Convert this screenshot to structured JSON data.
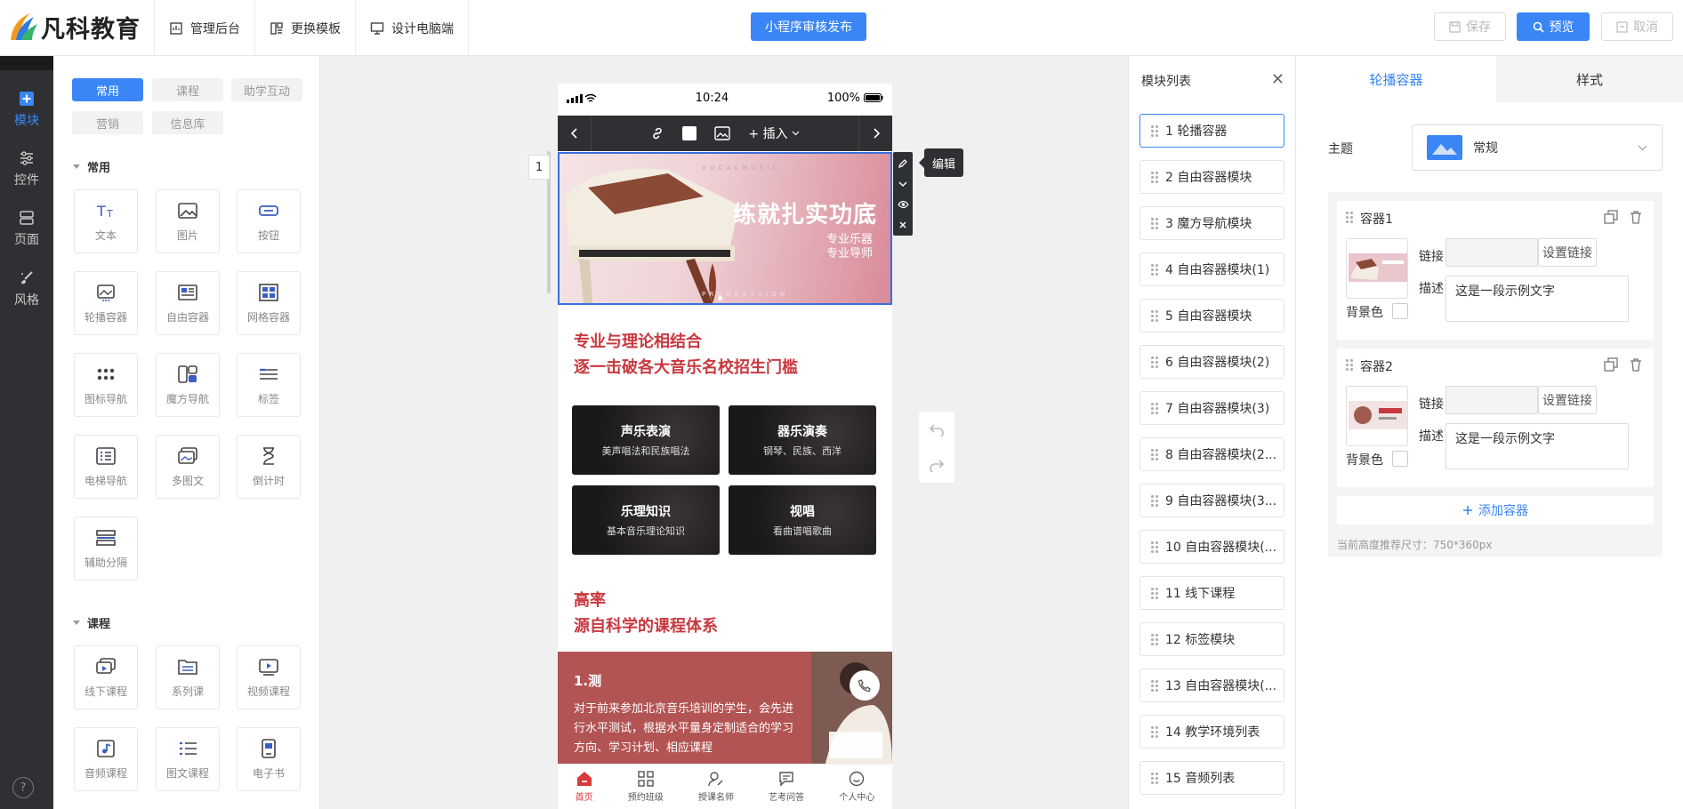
{
  "brand": {
    "name": "凡科教育"
  },
  "topnav": [
    {
      "label": "管理后台",
      "icon": "dashboard-icon"
    },
    {
      "label": "更换模板",
      "icon": "template-icon"
    },
    {
      "label": "设计电脑端",
      "icon": "monitor-icon"
    }
  ],
  "toolbar": {
    "publish_label": "小程序审核发布",
    "save_label": "保存",
    "preview_label": "预览",
    "cancel_label": "取消"
  },
  "rail": [
    {
      "label": "模块",
      "icon": "plus-square-icon",
      "active": true
    },
    {
      "label": "控件",
      "icon": "sliders-icon"
    },
    {
      "label": "页面",
      "icon": "pages-icon"
    },
    {
      "label": "风格",
      "icon": "brush-icon"
    }
  ],
  "palette": {
    "tabs": [
      "常用",
      "课程",
      "助学互动",
      "营销",
      "信息库"
    ],
    "sections": [
      {
        "title": "常用",
        "widgets": [
          "文本",
          "图片",
          "按钮",
          "轮播容器",
          "自由容器",
          "网格容器",
          "图标导航",
          "魔方导航",
          "标签",
          "电梯导航",
          "多图文",
          "倒计时",
          "辅助分隔"
        ]
      },
      {
        "title": "课程",
        "widgets": [
          "线下课程",
          "系列课",
          "视频课程",
          "音频课程",
          "图文课程",
          "电子书"
        ]
      }
    ]
  },
  "phone": {
    "time": "10:24",
    "battery": "100%",
    "insert_label": "+ 插入",
    "edit_tooltip": "编辑",
    "index_badge": "1",
    "banner": {
      "headline": "练就扎实功底",
      "sub1": "专业乐器",
      "sub2": "专业导师",
      "deco_top": "V O C A L   M U S I C",
      "deco_bottom": "P R O G R E S S I O N"
    },
    "headline1": [
      "专业与理论相结合",
      "逐一击破各大音乐名校招生门槛"
    ],
    "tiles": [
      {
        "title": "声乐表演",
        "sub": "美声唱法和民族唱法"
      },
      {
        "title": "器乐演奏",
        "sub": "钢琴、民族、西洋"
      },
      {
        "title": "乐理知识",
        "sub": "基本音乐理论知识"
      },
      {
        "title": "视唱",
        "sub": "看曲谱唱歌曲"
      }
    ],
    "headline2": [
      "高率",
      "源自科学的课程体系"
    ],
    "promo": {
      "title": "1.测",
      "text": "对于前来参加北京音乐培训的学生，会先进行水平测试，根据水平量身定制适合的学习方向、学习计划、相应课程"
    },
    "bottom_nav": [
      "首页",
      "预约班级",
      "授课名师",
      "艺考问答",
      "个人中心"
    ]
  },
  "modules": {
    "title": "模块列表",
    "items": [
      "1 轮播容器",
      "2 自由容器模块",
      "3 魔方导航模块",
      "4 自由容器模块(1)",
      "5 自由容器模块",
      "6 自由容器模块(2)",
      "7 自由容器模块(3)",
      "8 自由容器模块(2...",
      "9 自由容器模块(3...",
      "10 自由容器模块(...",
      "11 线下课程",
      "12 标签模块",
      "13 自由容器模块(...",
      "14 教学环境列表",
      "15 音频列表"
    ]
  },
  "props": {
    "tab_main": "轮播容器",
    "tab_style": "样式",
    "theme_label": "主题",
    "theme_value": "常规",
    "containers": [
      {
        "name": "容器1",
        "link_label": "链接",
        "link_btn": "设置链接",
        "desc_label": "描述",
        "desc": "这是一段示例文字",
        "bg_label": "背景色"
      },
      {
        "name": "容器2",
        "link_label": "链接",
        "link_btn": "设置链接",
        "desc_label": "描述",
        "desc": "这是一段示例文字",
        "bg_label": "背景色"
      }
    ],
    "add_label": "添加容器",
    "hint": "当前高度推荐尺寸：750*360px"
  },
  "colors": {
    "accent": "#3a86f7",
    "rail_bg": "#2e3033",
    "headline_red": "#c8393f",
    "promo_bg": "#b35454"
  }
}
